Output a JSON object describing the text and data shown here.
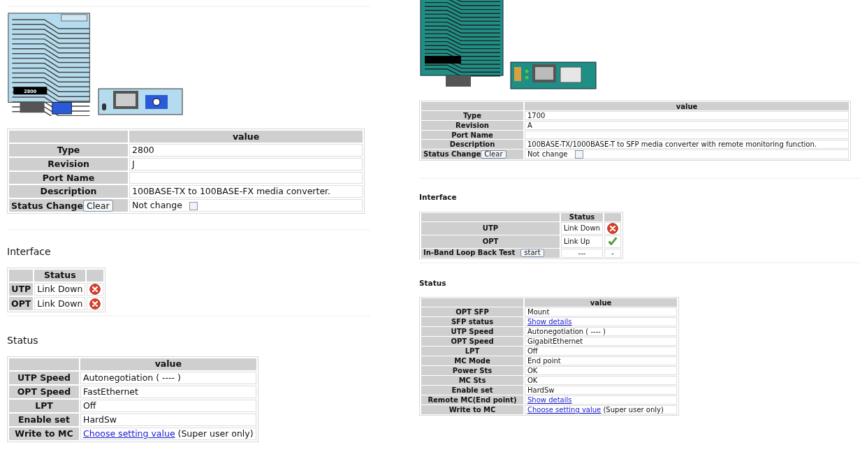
{
  "panels": [
    {
      "device": {
        "kind": "fx",
        "label": "2800"
      },
      "info": {
        "header": "value",
        "rows": [
          {
            "label": "Type",
            "value": "2800"
          },
          {
            "label": "Revision",
            "value": "J"
          },
          {
            "label": "Port Name",
            "value": ""
          },
          {
            "label": "Description",
            "value": "100BASE-TX to 100BASE-FX media converter."
          }
        ],
        "status_change": {
          "label": "Status Change",
          "button": "Clear",
          "text": "Not change",
          "checked": false
        }
      },
      "interface": {
        "title": "Interface",
        "header": "Status",
        "rows": [
          {
            "kind": "link",
            "label": "UTP",
            "status": "Link Down",
            "up": false
          },
          {
            "kind": "link",
            "label": "OPT",
            "status": "Link Down",
            "up": false
          }
        ]
      },
      "status": {
        "title": "Status",
        "header": "value",
        "rows": [
          {
            "label": "UTP Speed",
            "value": "Autonegotiation ( ---- )"
          },
          {
            "label": "OPT Speed",
            "value": "FastEthernet"
          },
          {
            "label": "LPT",
            "value": "Off"
          },
          {
            "label": "Enable set",
            "value": "HardSw"
          },
          {
            "label": "Write to MC",
            "link": "Choose setting value",
            "value": "(Super user only)"
          }
        ]
      }
    },
    {
      "device": {
        "kind": "sfp"
      },
      "info": {
        "header": "value",
        "rows": [
          {
            "label": "Type",
            "value": "1700"
          },
          {
            "label": "Revision",
            "value": "A"
          },
          {
            "label": "Port Name",
            "value": ""
          },
          {
            "label": "Description",
            "value": "100BASE-TX/1000BASE-T to SFP media converter with remote monitoring function."
          }
        ],
        "status_change": {
          "label": "Status Change",
          "button": "Clear",
          "text": "Not change",
          "checked": false
        }
      },
      "interface": {
        "title": "Interface",
        "header": "Status",
        "rows": [
          {
            "kind": "link",
            "label": "UTP",
            "status": "Link Down",
            "up": false
          },
          {
            "kind": "link",
            "label": "OPT",
            "status": "Link Up",
            "up": true
          },
          {
            "kind": "test",
            "label": "In-Band Loop Back Test",
            "button": "start",
            "status": "---",
            "result": "-"
          }
        ]
      },
      "status": {
        "title": "Status",
        "header": "value",
        "rows": [
          {
            "label": "OPT SFP",
            "value": "Mount"
          },
          {
            "label": "SFP status",
            "link": "Show details"
          },
          {
            "label": "UTP Speed",
            "value": "Autonegotiation ( ---- )"
          },
          {
            "label": "OPT Speed",
            "value": "GigabitEthernet"
          },
          {
            "label": "LPT",
            "value": "Off"
          },
          {
            "label": "MC Mode",
            "value": "End point"
          },
          {
            "label": "Power Sts",
            "value": "OK"
          },
          {
            "label": "MC Sts",
            "value": "OK"
          },
          {
            "label": "Enable set",
            "value": "HardSw"
          },
          {
            "label": "Remote MC(End point)",
            "link": "Show details"
          },
          {
            "label": "Write to MC",
            "link": "Choose setting value",
            "value": "(Super user only)"
          }
        ]
      }
    }
  ]
}
